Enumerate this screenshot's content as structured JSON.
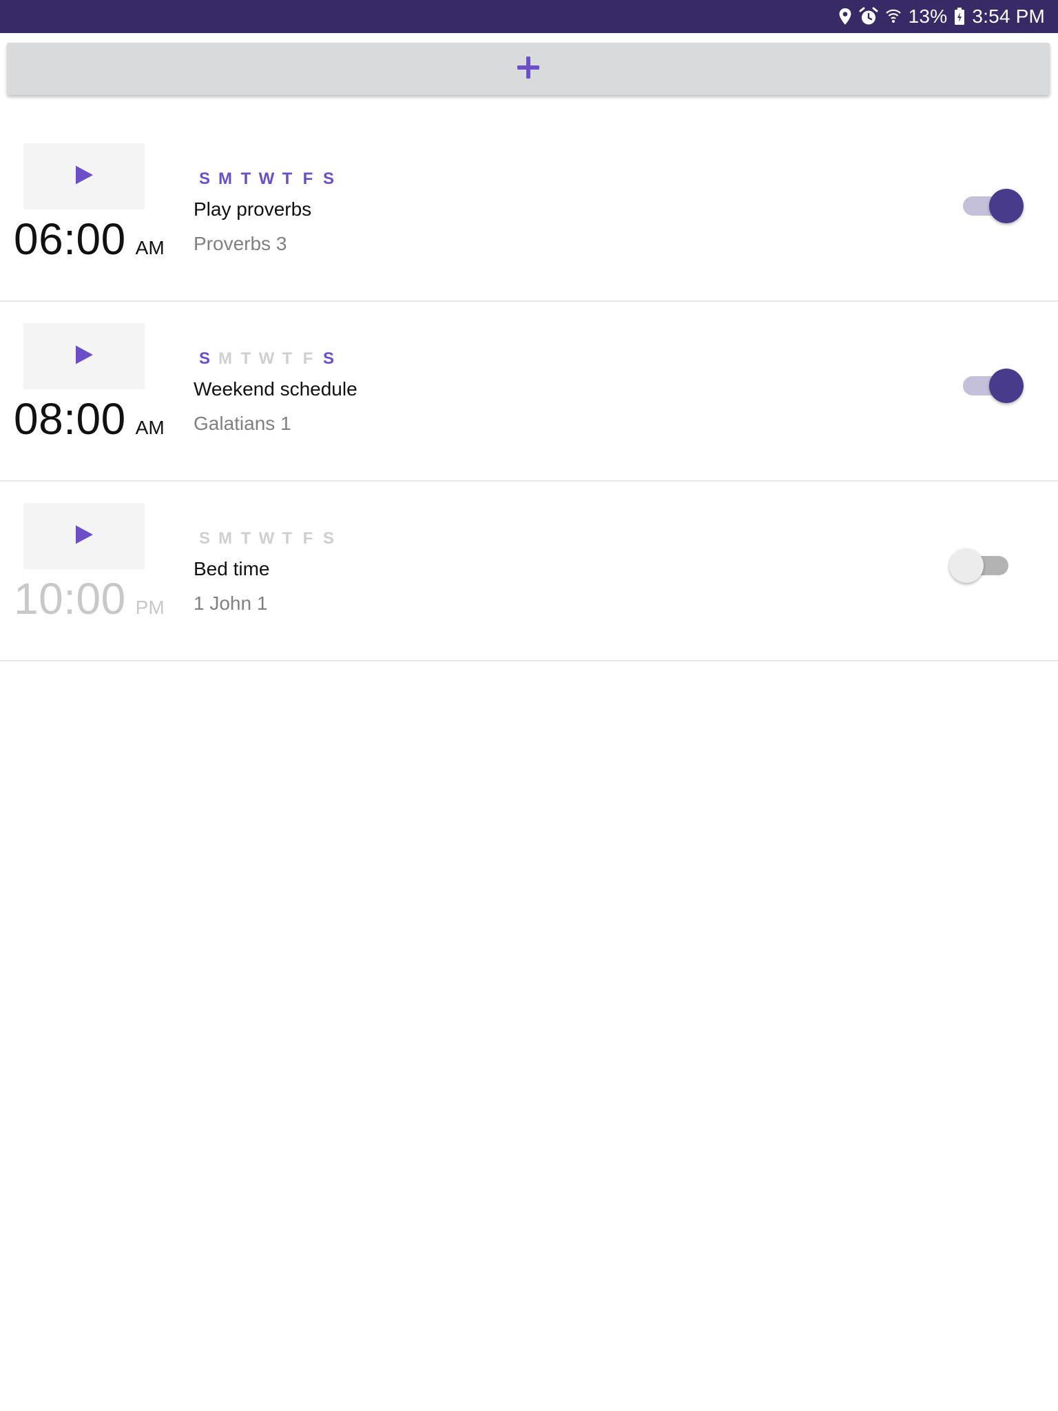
{
  "status_bar": {
    "battery": "13%",
    "time": "3:54 PM",
    "icons": [
      "location-icon",
      "alarm-icon",
      "wifi-icon",
      "battery-icon"
    ]
  },
  "add_bar": {
    "icon": "plus-icon",
    "accent": "#6a4fc8"
  },
  "alarms": [
    {
      "time": "06:00",
      "ampm": "AM",
      "days": [
        {
          "letter": "S",
          "active": true
        },
        {
          "letter": "M",
          "active": true
        },
        {
          "letter": "T",
          "active": true
        },
        {
          "letter": "W",
          "active": true
        },
        {
          "letter": "T",
          "active": true
        },
        {
          "letter": "F",
          "active": true
        },
        {
          "letter": "S",
          "active": true
        }
      ],
      "title": "Play proverbs",
      "subtitle": "Proverbs 3",
      "enabled": true
    },
    {
      "time": "08:00",
      "ampm": "AM",
      "days": [
        {
          "letter": "S",
          "active": true
        },
        {
          "letter": "M",
          "active": false
        },
        {
          "letter": "T",
          "active": false
        },
        {
          "letter": "W",
          "active": false
        },
        {
          "letter": "T",
          "active": false
        },
        {
          "letter": "F",
          "active": false
        },
        {
          "letter": "S",
          "active": true
        }
      ],
      "title": "Weekend schedule",
      "subtitle": "Galatians 1",
      "enabled": true
    },
    {
      "time": "10:00",
      "ampm": "PM",
      "days": [
        {
          "letter": "S",
          "active": false
        },
        {
          "letter": "M",
          "active": false
        },
        {
          "letter": "T",
          "active": false
        },
        {
          "letter": "W",
          "active": false
        },
        {
          "letter": "T",
          "active": false
        },
        {
          "letter": "F",
          "active": false
        },
        {
          "letter": "S",
          "active": false
        }
      ],
      "title": "Bed time",
      "subtitle": "1 John 1",
      "enabled": false
    }
  ],
  "colors": {
    "status_bar_bg": "#372a66",
    "accent": "#6a4fc8",
    "toggle_on_thumb": "#493b8c",
    "toggle_on_track": "#c5c0d9",
    "inactive_day": "#cfcfcf"
  }
}
